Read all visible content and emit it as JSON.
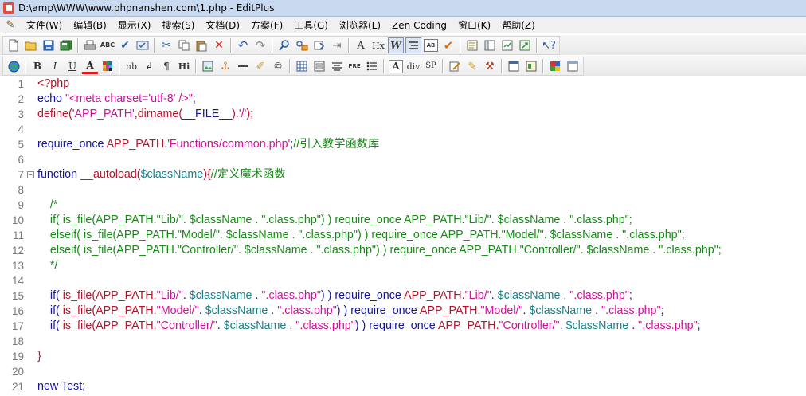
{
  "window": {
    "title": "D:\\amp\\WWW\\www.phpnanshen.com\\1.php - EditPlus"
  },
  "menu": [
    "文件(W)",
    "编辑(B)",
    "显示(X)",
    "搜索(S)",
    "文档(D)",
    "方案(F)",
    "工具(G)",
    "浏览器(L)",
    "Zen Coding",
    "窗口(K)",
    "帮助(Z)"
  ],
  "toolbar1": {
    "spell_label": "ABC",
    "font_label": "A",
    "hx_label": "Hx",
    "w_label": "W",
    "ab_label": "AB"
  },
  "toolbar2": {
    "bold_label": "B",
    "italic_label": "I",
    "underline_label": "U",
    "font_color_label": "A",
    "nb_label": "nb",
    "br_label": "↲",
    "para_label": "¶",
    "hi_label": "Hi",
    "pre_label": "PRE",
    "div_label": "div",
    "sp_label": "SP"
  },
  "icons": {
    "new": "new-file-icon",
    "open": "open-folder-icon",
    "save": "save-icon",
    "save_all": "save-all-icon",
    "print": "print-icon",
    "print_preview": "print-preview-icon",
    "spell": "spell-check-icon",
    "check": "check-icon",
    "settings": "settings-icon",
    "cut": "cut-icon",
    "copy": "copy-icon",
    "paste": "paste-icon",
    "delete": "delete-icon",
    "undo": "undo-icon",
    "redo": "redo-icon",
    "find": "find-icon",
    "replace": "replace-icon",
    "browser": "globe-icon"
  },
  "colors": {
    "keyword": "#1414a0",
    "string": "#d0109a",
    "comment": "#178a17",
    "variable": "#1a7f8a",
    "function": "#b3132b",
    "line_number": "#7a7a7a"
  },
  "editor": {
    "lines": [
      {
        "n": "1",
        "segs": [
          {
            "t": "<?php",
            "c": "m"
          }
        ]
      },
      {
        "n": "2",
        "segs": [
          {
            "t": "echo ",
            "c": "k"
          },
          {
            "t": "\"<meta charset='utf-8' />\"",
            "c": "s"
          },
          {
            "t": ";",
            "c": "k"
          }
        ]
      },
      {
        "n": "3",
        "segs": [
          {
            "t": "define(",
            "c": "m"
          },
          {
            "t": "'APP_PATH'",
            "c": "s"
          },
          {
            "t": ",dirname(",
            "c": "m"
          },
          {
            "t": "__FILE__",
            "c": "k"
          },
          {
            "t": ").",
            "c": "m"
          },
          {
            "t": "'/'",
            "c": "s"
          },
          {
            "t": ");",
            "c": "m"
          }
        ]
      },
      {
        "n": "4",
        "segs": []
      },
      {
        "n": "5",
        "segs": [
          {
            "t": "require_once ",
            "c": "k"
          },
          {
            "t": "APP_PATH",
            "c": "m"
          },
          {
            "t": ".",
            "c": "k"
          },
          {
            "t": "'Functions/common.php'",
            "c": "s"
          },
          {
            "t": ";",
            "c": "k"
          },
          {
            "t": "//引入教学函数库",
            "c": "c"
          }
        ]
      },
      {
        "n": "6",
        "segs": []
      },
      {
        "n": "7",
        "fold": true,
        "segs": [
          {
            "t": "function ",
            "c": "k"
          },
          {
            "t": "__autoload(",
            "c": "m"
          },
          {
            "t": "$className",
            "c": "v"
          },
          {
            "t": "){",
            "c": "m"
          },
          {
            "t": "//定义魔术函数",
            "c": "c"
          }
        ]
      },
      {
        "n": "8",
        "segs": []
      },
      {
        "n": "9",
        "segs": [
          {
            "t": "    /*",
            "c": "c"
          }
        ]
      },
      {
        "n": "10",
        "segs": [
          {
            "t": "    if( is_file(APP_PATH.\"Lib/\". $className . \".class.php\") ) require_once APP_PATH.\"Lib/\". $className . \".class.php\";",
            "c": "c"
          }
        ]
      },
      {
        "n": "11",
        "segs": [
          {
            "t": "    elseif( is_file(APP_PATH.\"Model/\". $className . \".class.php\") ) require_once APP_PATH.\"Model/\". $className . \".class.php\";",
            "c": "c"
          }
        ]
      },
      {
        "n": "12",
        "segs": [
          {
            "t": "    elseif( is_file(APP_PATH.\"Controller/\". $className . \".class.php\") ) require_once APP_PATH.\"Controller/\". $className . \".class.php\";",
            "c": "c"
          }
        ]
      },
      {
        "n": "13",
        "segs": [
          {
            "t": "    */",
            "c": "c"
          }
        ]
      },
      {
        "n": "14",
        "segs": []
      },
      {
        "n": "15",
        "segs": [
          {
            "t": "    if( ",
            "c": "k"
          },
          {
            "t": "is_file(APP_PATH.",
            "c": "m"
          },
          {
            "t": "\"Lib/\"",
            "c": "s"
          },
          {
            "t": ". ",
            "c": "k"
          },
          {
            "t": "$className",
            "c": "v"
          },
          {
            "t": " . ",
            "c": "k"
          },
          {
            "t": "\".class.php\"",
            "c": "s"
          },
          {
            "t": ") ) require_once ",
            "c": "k"
          },
          {
            "t": "APP_PATH.",
            "c": "m"
          },
          {
            "t": "\"Lib/\"",
            "c": "s"
          },
          {
            "t": ". ",
            "c": "k"
          },
          {
            "t": "$className",
            "c": "v"
          },
          {
            "t": " . ",
            "c": "k"
          },
          {
            "t": "\".class.php\"",
            "c": "s"
          },
          {
            "t": ";",
            "c": "k"
          }
        ]
      },
      {
        "n": "16",
        "segs": [
          {
            "t": "    if( ",
            "c": "k"
          },
          {
            "t": "is_file(APP_PATH.",
            "c": "m"
          },
          {
            "t": "\"Model/\"",
            "c": "s"
          },
          {
            "t": ". ",
            "c": "k"
          },
          {
            "t": "$className",
            "c": "v"
          },
          {
            "t": " . ",
            "c": "k"
          },
          {
            "t": "\".class.php\"",
            "c": "s"
          },
          {
            "t": ") ) require_once ",
            "c": "k"
          },
          {
            "t": "APP_PATH.",
            "c": "m"
          },
          {
            "t": "\"Model/\"",
            "c": "s"
          },
          {
            "t": ". ",
            "c": "k"
          },
          {
            "t": "$className",
            "c": "v"
          },
          {
            "t": " . ",
            "c": "k"
          },
          {
            "t": "\".class.php\"",
            "c": "s"
          },
          {
            "t": ";",
            "c": "k"
          }
        ]
      },
      {
        "n": "17",
        "segs": [
          {
            "t": "    if( ",
            "c": "k"
          },
          {
            "t": "is_file(APP_PATH.",
            "c": "m"
          },
          {
            "t": "\"Controller/\"",
            "c": "s"
          },
          {
            "t": ". ",
            "c": "k"
          },
          {
            "t": "$className",
            "c": "v"
          },
          {
            "t": " . ",
            "c": "k"
          },
          {
            "t": "\".class.php\"",
            "c": "s"
          },
          {
            "t": ") ) require_once ",
            "c": "k"
          },
          {
            "t": "APP_PATH.",
            "c": "m"
          },
          {
            "t": "\"Controller/\"",
            "c": "s"
          },
          {
            "t": ". ",
            "c": "k"
          },
          {
            "t": "$className",
            "c": "v"
          },
          {
            "t": " . ",
            "c": "k"
          },
          {
            "t": "\".class.php\"",
            "c": "s"
          },
          {
            "t": ";",
            "c": "k"
          }
        ]
      },
      {
        "n": "18",
        "segs": []
      },
      {
        "n": "19",
        "segs": [
          {
            "t": "}",
            "c": "m"
          }
        ]
      },
      {
        "n": "20",
        "segs": []
      },
      {
        "n": "21",
        "segs": [
          {
            "t": "new Test;",
            "c": "k"
          }
        ]
      }
    ]
  }
}
